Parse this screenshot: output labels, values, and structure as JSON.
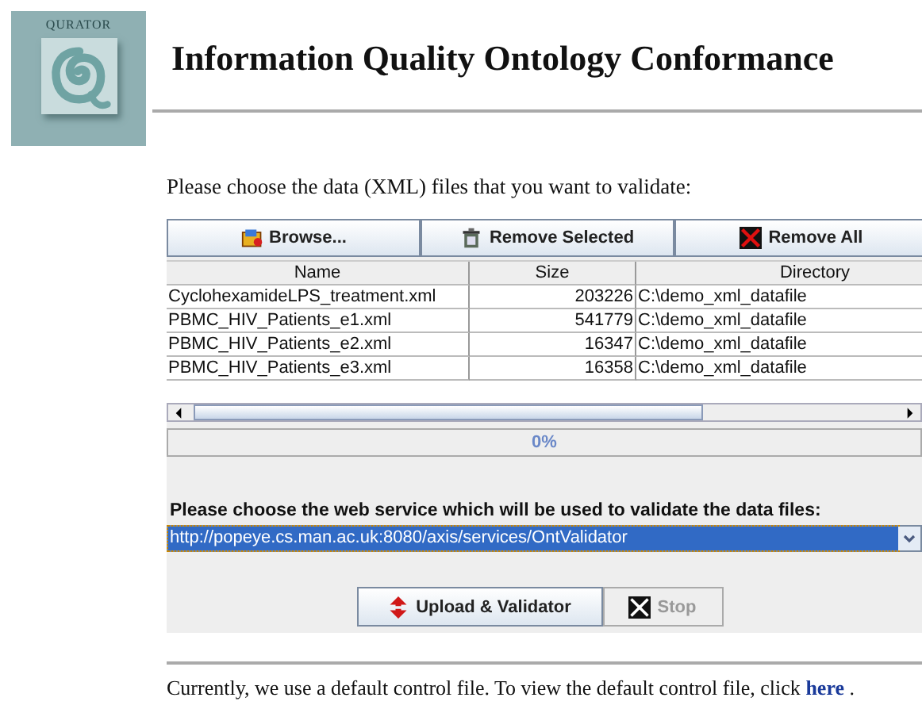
{
  "logo": {
    "text": "QURATOR"
  },
  "title": "Information Quality Ontology Conformance",
  "instruction": "Please choose the data (XML) files that you want to validate:",
  "file_buttons": [
    {
      "label": "Browse...",
      "kind": "browse"
    },
    {
      "label": "Remove Selected",
      "kind": "remove-selected"
    },
    {
      "label": "Remove All",
      "kind": "remove-all"
    }
  ],
  "table": {
    "columns": [
      "Name",
      "Size",
      "Directory"
    ],
    "rows": [
      [
        "CyclohexamideLPS_treatment.xml",
        "203226",
        "C:\\demo_xml_datafile"
      ],
      [
        "PBMC_HIV_Patients_e1.xml",
        "541779",
        "C:\\demo_xml_datafile"
      ],
      [
        "PBMC_HIV_Patients_e2.xml",
        "16347",
        "C:\\demo_xml_datafile"
      ],
      [
        "PBMC_HIV_Patients_e3.xml",
        "16358",
        "C:\\demo_xml_datafile"
      ]
    ]
  },
  "progress": {
    "level": 0,
    "reading": "0%"
  },
  "service": {
    "label": "Please choose the web service which will be used to validate the data files:",
    "value": "http://popeye.cs.man.ac.uk:8080/axis/services/OntValidator",
    "highlighted": true
  },
  "actions": [
    {
      "label": "Upload & Validator",
      "kind": "upload",
      "disabled": false
    },
    {
      "label": "Stop",
      "kind": "stop",
      "disabled": true
    }
  ],
  "footer": {
    "text": "Currently, we use a default control file. To view the default control file, click",
    "link": "here",
    "end": "."
  }
}
